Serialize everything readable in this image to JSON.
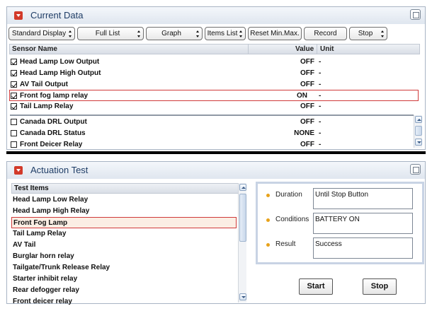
{
  "current_data": {
    "title": "Current Data",
    "toolbar": {
      "standard_display": "Standard Display",
      "full_list": "Full List",
      "graph": "Graph",
      "items_list": "Items List",
      "reset_min_max": "Reset Min.Max.",
      "record": "Record",
      "stop": "Stop"
    },
    "columns": {
      "sensor_name": "Sensor Name",
      "value": "Value",
      "unit": "Unit"
    },
    "rows": [
      {
        "checked": true,
        "name": "Head Lamp Low Output",
        "value": "OFF",
        "unit": "-"
      },
      {
        "checked": true,
        "name": "Head Lamp High Output",
        "value": "OFF",
        "unit": "-"
      },
      {
        "checked": true,
        "name": "AV Tail Output",
        "value": "OFF",
        "unit": "-"
      },
      {
        "checked": true,
        "name": "Front fog lamp relay",
        "value": "ON",
        "unit": "-",
        "selected": true
      },
      {
        "checked": true,
        "name": "Tail Lamp Relay",
        "value": "OFF",
        "unit": "-"
      },
      {
        "checked": false,
        "name": "Canada DRL Output",
        "value": "OFF",
        "unit": "-"
      },
      {
        "checked": false,
        "name": "Canada DRL Status",
        "value": "NONE",
        "unit": "-"
      },
      {
        "checked": false,
        "name": "Front Deicer Relay",
        "value": "OFF",
        "unit": "-"
      }
    ]
  },
  "actuation_test": {
    "title": "Actuation Test",
    "list_header": "Test Items",
    "items": [
      "Head Lamp Low Relay",
      "Head Lamp High Relay",
      "Front Fog Lamp",
      "Tail Lamp Relay",
      "AV Tail",
      "Burglar horn relay",
      "Tailgate/Trunk Release Relay",
      "Starter inhibit relay",
      "Rear defogger relay",
      "Front deicer relay"
    ],
    "selected_index": 2,
    "fields": {
      "duration_label": "Duration",
      "duration_value": "Until Stop Button",
      "conditions_label": "Conditions",
      "conditions_value": "BATTERY ON",
      "result_label": "Result",
      "result_value": "Success"
    },
    "start_label": "Start",
    "stop_label": "Stop"
  },
  "colors": {
    "highlight_border": "#d03a3a",
    "title_text": "#1f3d66",
    "bullet": "#e8a21a"
  }
}
